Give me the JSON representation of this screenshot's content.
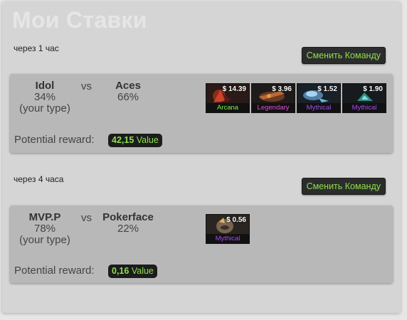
{
  "page": {
    "title": "Мои Ставки"
  },
  "bets": [
    {
      "time": "через 1 час",
      "change_label": "Сменить Команду",
      "team1": {
        "name": "Idol",
        "pct": "34%",
        "note": "(your type)"
      },
      "vs": "vs",
      "team2": {
        "name": "Aces",
        "pct": "66%"
      },
      "reward_label": "Potential reward:",
      "reward_value": "42,15",
      "reward_unit": "Value",
      "items": [
        {
          "price": "$ 14.39",
          "rarity": "Arcana",
          "rarity_color": "#7cf34c",
          "icon": "arcana-hero-icon"
        },
        {
          "price": "$ 3.96",
          "rarity": "Legendary",
          "rarity_color": "#e04cd8",
          "icon": "legendary-weapon-icon"
        },
        {
          "price": "$ 1.52",
          "rarity": "Mythical",
          "rarity_color": "#a34cf2",
          "icon": "mythical-courier-icon"
        },
        {
          "price": "$ 1.90",
          "rarity": "Mythical",
          "rarity_color": "#a34cf2",
          "icon": "mythical-ward-icon"
        }
      ]
    },
    {
      "time": "через 4 часа",
      "change_label": "Сменить Команду",
      "team1": {
        "name": "MVP.P",
        "pct": "78%",
        "note": "(your type)"
      },
      "vs": "vs",
      "team2": {
        "name": "Pokerface",
        "pct": "22%"
      },
      "reward_label": "Potential reward:",
      "reward_value": "0,16",
      "reward_unit": "Value",
      "items": [
        {
          "price": "$ 0.56",
          "rarity": "Mythical",
          "rarity_color": "#a34cf2",
          "icon": "mythical-helmet-icon"
        }
      ]
    }
  ]
}
